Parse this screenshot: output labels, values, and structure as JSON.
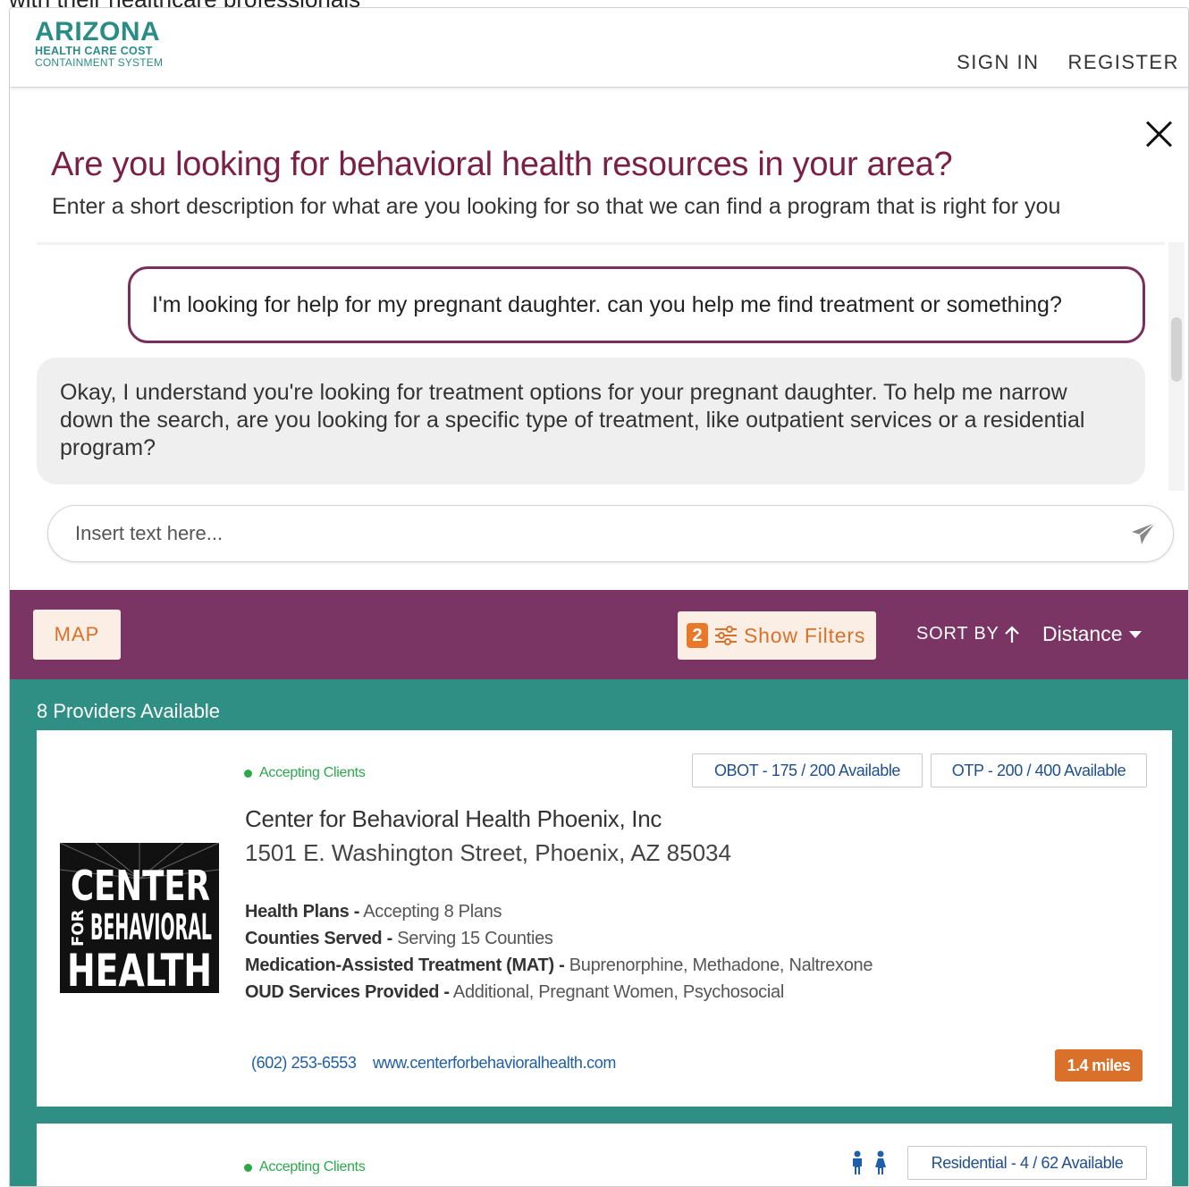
{
  "background_text": "with their healthcare professionals",
  "header": {
    "logo": {
      "line1": "ARIZONA",
      "line2": "HEALTH CARE COST",
      "line3": "CONTAINMENT SYSTEM"
    },
    "nav": {
      "sign_in": "SIGN IN",
      "register": "REGISTER"
    }
  },
  "chat": {
    "title": "Are you looking for behavioral health resources in your area?",
    "subtitle": "Enter a short description for what are you looking for so that we can find a program that is right for you",
    "messages": [
      {
        "role": "user",
        "text": "I'm looking for help for my pregnant daughter. can you help me find treatment or something?"
      },
      {
        "role": "bot",
        "text": "Okay, I understand you're looking for treatment options for your pregnant daughter. To help me narrow down the search, are you looking for a specific type of treatment, like outpatient services or a residential program?"
      }
    ],
    "input": {
      "placeholder": "Insert text here...",
      "value": ""
    }
  },
  "toolbar": {
    "map_label": "MAP",
    "filter_count": "2",
    "filter_label": "Show Filters",
    "sort_label": "SORT BY",
    "sort_value": "Distance"
  },
  "results": {
    "count_label": "8 Providers Available",
    "providers": [
      {
        "status": "Accepting Clients",
        "badges": [
          "OBOT - 175 / 200 Available",
          "OTP - 200 / 400 Available"
        ],
        "name": "Center for Behavioral Health Phoenix, Inc",
        "address": "1501 E. Washington Street, Phoenix, AZ 85034",
        "logo_text": {
          "top": "CENTER",
          "side": "FOR",
          "middle": "BEHAVIORAL",
          "bottom": "HEALTH"
        },
        "details": [
          {
            "label": "Health Plans -",
            "value": "Accepting 8 Plans"
          },
          {
            "label": "Counties Served -",
            "value": "Serving 15 Counties"
          },
          {
            "label": "Medication-Assisted Treatment (MAT) -",
            "value": "Buprenorphine, Methadone, Naltrexone"
          },
          {
            "label": "OUD Services Provided -",
            "value": "Additional, Pregnant Women, Psychosocial"
          }
        ],
        "phone": "(602) 253-6553",
        "website": "www.centerforbehavioralhealth.com",
        "distance": "1.4 miles"
      },
      {
        "status": "Accepting Clients",
        "badges": [
          "Residential - 4 / 62 Available"
        ]
      }
    ]
  },
  "colors": {
    "brand_purple": "#7b3565",
    "title_maroon": "#7a1f45",
    "teal": "#2f8f85",
    "orange": "#d9712b",
    "green": "#2aa84a",
    "link_blue": "#1f5fa8"
  }
}
